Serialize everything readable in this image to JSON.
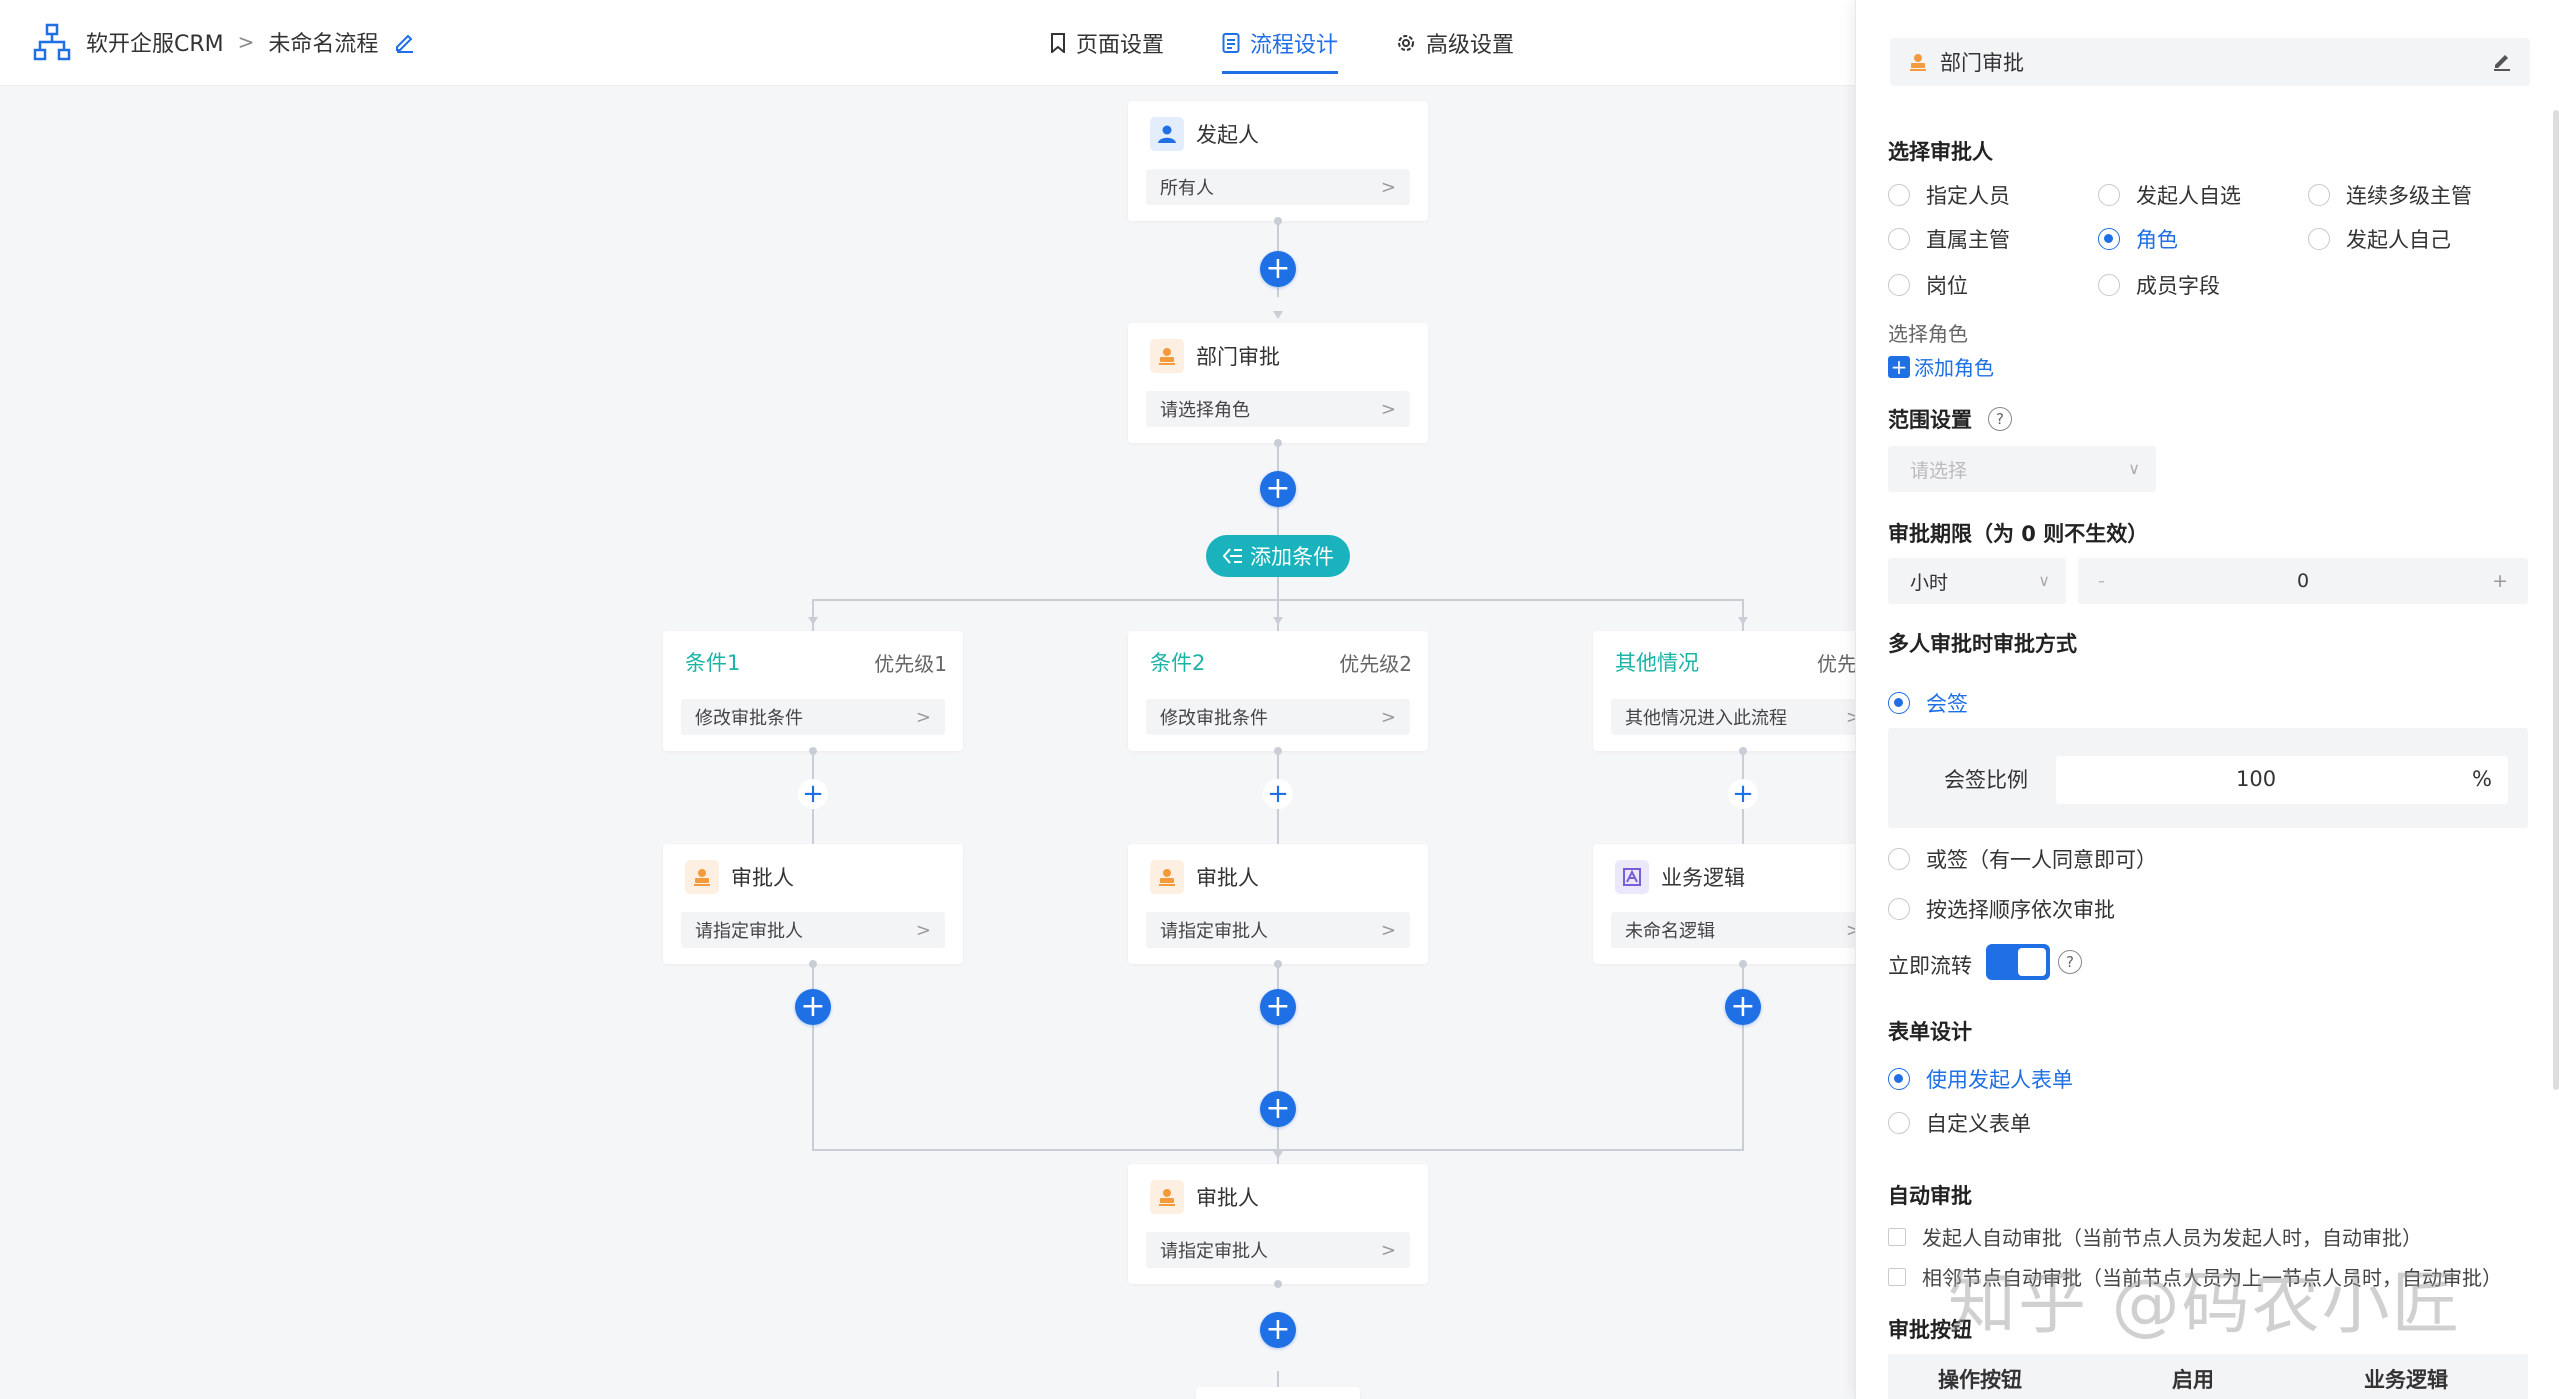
{
  "header": {
    "app_name": "软开企服CRM",
    "flow_name": "未命名流程",
    "tabs": [
      {
        "label": "页面设置"
      },
      {
        "label": "流程设计"
      },
      {
        "label": "高级设置"
      }
    ]
  },
  "flow": {
    "start": {
      "title": "发起人",
      "value": "所有人"
    },
    "dept": {
      "title": "部门审批",
      "value": "请选择角色"
    },
    "add_condition": "添加条件",
    "conditions": [
      {
        "title": "条件1",
        "priority": "优先级1",
        "value": "修改审批条件"
      },
      {
        "title": "条件2",
        "priority": "优先级2",
        "value": "修改审批条件"
      },
      {
        "title": "其他情况",
        "priority": "优先级",
        "value": "其他情况进入此流程"
      }
    ],
    "branch_nodes": [
      {
        "title": "审批人",
        "value": "请指定审批人"
      },
      {
        "title": "审批人",
        "value": "请指定审批人"
      },
      {
        "title": "业务逻辑",
        "value": "未命名逻辑"
      }
    ],
    "final": {
      "title": "审批人",
      "value": "请指定审批人"
    }
  },
  "panel": {
    "title": "部门审批",
    "approver_section": "选择审批人",
    "approver_options": [
      "指定人员",
      "发起人自选",
      "连续多级主管",
      "直属主管",
      "角色",
      "发起人自己",
      "岗位",
      "成员字段"
    ],
    "role_label": "选择角色",
    "add_role": "添加角色",
    "scope_section": "范围设置",
    "scope_placeholder": "请选择",
    "deadline_section": "审批期限（为 0 则不生效）",
    "deadline_unit": "小时",
    "deadline_minus": "-",
    "deadline_value": "0",
    "deadline_plus": "+",
    "multi_section": "多人审批时审批方式",
    "multi_options": [
      "会签",
      "或签（有一人同意即可）",
      "按选择顺序依次审批"
    ],
    "ratio_label": "会签比例",
    "ratio_value": "100",
    "ratio_unit": "%",
    "immediate_label": "立即流转",
    "form_section": "表单设计",
    "form_options": [
      "使用发起人表单",
      "自定义表单"
    ],
    "auto_section": "自动审批",
    "auto_options": [
      "发起人自动审批（当前节点人员为发起人时，自动审批）",
      "相邻节点自动审批（当前节点人员为上一节点人员时，自动审批）"
    ],
    "buttons_section": "审批按钮",
    "table_headers": [
      "操作按钮",
      "启用",
      "业务逻辑"
    ]
  },
  "watermark": "知乎 @码农小匠",
  "colors": {
    "primary": "#1f6fe5",
    "teal": "#1ab3bd",
    "orange": "#f39a3d"
  }
}
